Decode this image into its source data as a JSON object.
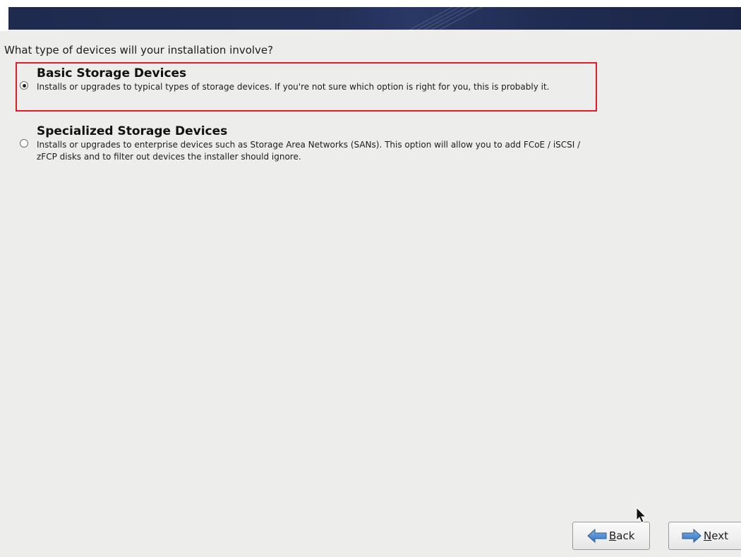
{
  "header": {
    "banner_color": "#1e2a4e"
  },
  "main": {
    "question": "What type of devices will your installation involve?",
    "options": [
      {
        "title": "Basic Storage Devices",
        "description": "Installs or upgrades to typical types of storage devices.  If you're not sure which option is right for you, this is probably it.",
        "selected": true,
        "highlight_color": "#e21d28"
      },
      {
        "title": "Specialized Storage Devices",
        "description": "Installs or upgrades to enterprise devices such as Storage Area Networks (SANs). This option will allow you to add FCoE / iSCSI / zFCP disks and to filter out devices the installer should ignore.",
        "selected": false
      }
    ]
  },
  "footer": {
    "back_button": {
      "label_accel": "B",
      "label_rest": "ack",
      "icon": "arrow-left-icon"
    },
    "next_button": {
      "label_accel": "N",
      "label_rest": "ext",
      "icon": "arrow-right-icon"
    }
  },
  "cursor": {
    "icon": "mouse-pointer-icon"
  }
}
